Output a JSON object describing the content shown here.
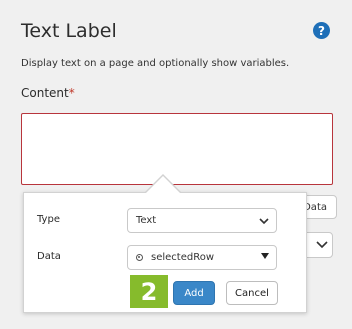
{
  "header": {
    "title": "Text Label",
    "help_icon": "question-circle-icon",
    "description": "Display text on a page and optionally show variables."
  },
  "content": {
    "label": "Content",
    "required_mark": "*",
    "value": ""
  },
  "background": {
    "data_button_label": "Data",
    "select_icon": "chevron-down-icon"
  },
  "popover": {
    "type": {
      "label": "Type",
      "value": "Text",
      "icon": "chevron-down-icon"
    },
    "data": {
      "label": "Data",
      "value": "selectedRow",
      "icon": "variable-icon",
      "caret": "caret-down-icon"
    },
    "step_badge": "2",
    "add_label": "Add",
    "cancel_label": "Cancel"
  },
  "colors": {
    "accent": "#3a87c8",
    "error_border": "#b8353c",
    "badge": "#86bb2c",
    "help": "#1e6fb8"
  }
}
